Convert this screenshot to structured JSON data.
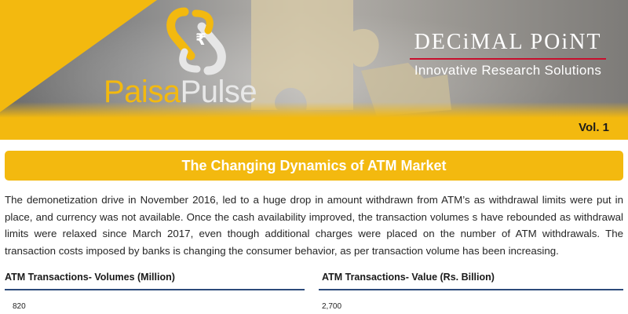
{
  "header": {
    "brand_part1": "Paisa",
    "brand_part2": "Pulse",
    "logo_icon": "rupee-chain-link-icon",
    "partner_name": "DECiMAL POiNT",
    "partner_tagline": "Innovative Research Solutions",
    "volume": "Vol. 1",
    "colors": {
      "accent_yellow": "#f3b90f",
      "partner_rule": "#c8102e"
    }
  },
  "article": {
    "title": "The Changing Dynamics of ATM Market",
    "body": "The demonetization drive in November 2016, led to a huge drop in amount withdrawn from ATM’s as withdrawal limits were put in place, and currency was not available. Once the cash availability improved, the transaction volumes s have rebounded as withdrawal limits were relaxed since March 2017, even though additional charges were placed on the number of ATM withdrawals. The transaction costs imposed by banks is changing the consumer behavior, as per transaction volume has been increasing."
  },
  "charts": {
    "left": {
      "title": "ATM Transactions- Volumes (Million)",
      "top_tick": "820"
    },
    "right": {
      "title": "ATM Transactions- Value (Rs. Billion)",
      "top_tick": "2,700"
    }
  }
}
